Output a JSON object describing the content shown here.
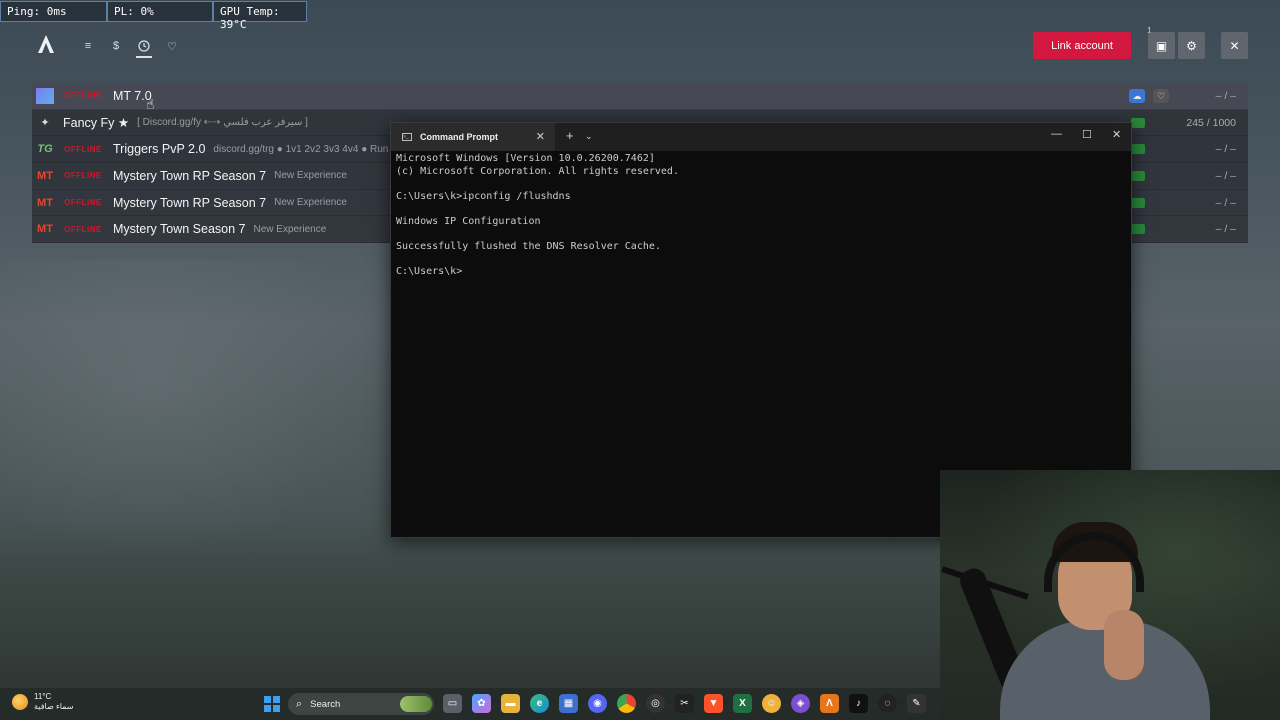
{
  "stats": {
    "ping": "Ping: 0ms",
    "pl": "PL: 0%",
    "gpu": "GPU Temp: 39°C"
  },
  "launcher": {
    "logo_icon": "launcher-logo-icon",
    "nav_icons": [
      "list-icon",
      "dollar-icon",
      "clock-icon",
      "heart-icon"
    ],
    "link_account_label": "Link account",
    "notification_count": "1",
    "accent_color": "#d3183f"
  },
  "servers": [
    {
      "status": "OFFLINE",
      "name": "MT 7.0",
      "desc": "",
      "players": "– / –"
    },
    {
      "status": "",
      "name": "Fancy Fy ★",
      "desc": "[ Discord.gg/fy ⇠⇢ سيرفر عرب فلسي ]",
      "players": "245 / 1000"
    },
    {
      "status": "OFFLINE",
      "name": "Triggers PvP 2.0",
      "desc": "discord.gg/trg ● 1v1 2v2 3v3 4v4 ● Run",
      "players": "– / –"
    },
    {
      "status": "OFFLINE",
      "name": "Mystery Town RP Season 7",
      "desc": "New Experience",
      "players": "– / –"
    },
    {
      "status": "OFFLINE",
      "name": "Mystery Town RP Season 7",
      "desc": "New Experience",
      "players": "– / –"
    },
    {
      "status": "OFFLINE",
      "name": "Mystery Town Season 7",
      "desc": "New Experience",
      "players": "– / –"
    }
  ],
  "cmd": {
    "tab_title": "Command Prompt",
    "lines": [
      "Microsoft Windows [Version 10.0.26200.7462]",
      "(c) Microsoft Corporation. All rights reserved.",
      "",
      "C:\\Users\\k>ipconfig /flushdns",
      "",
      "Windows IP Configuration",
      "",
      "Successfully flushed the DNS Resolver Cache.",
      "",
      "C:\\Users\\k>"
    ]
  },
  "taskbar": {
    "weather_temp": "11°C",
    "weather_desc": "سماء صافية",
    "search_label": "Search"
  }
}
